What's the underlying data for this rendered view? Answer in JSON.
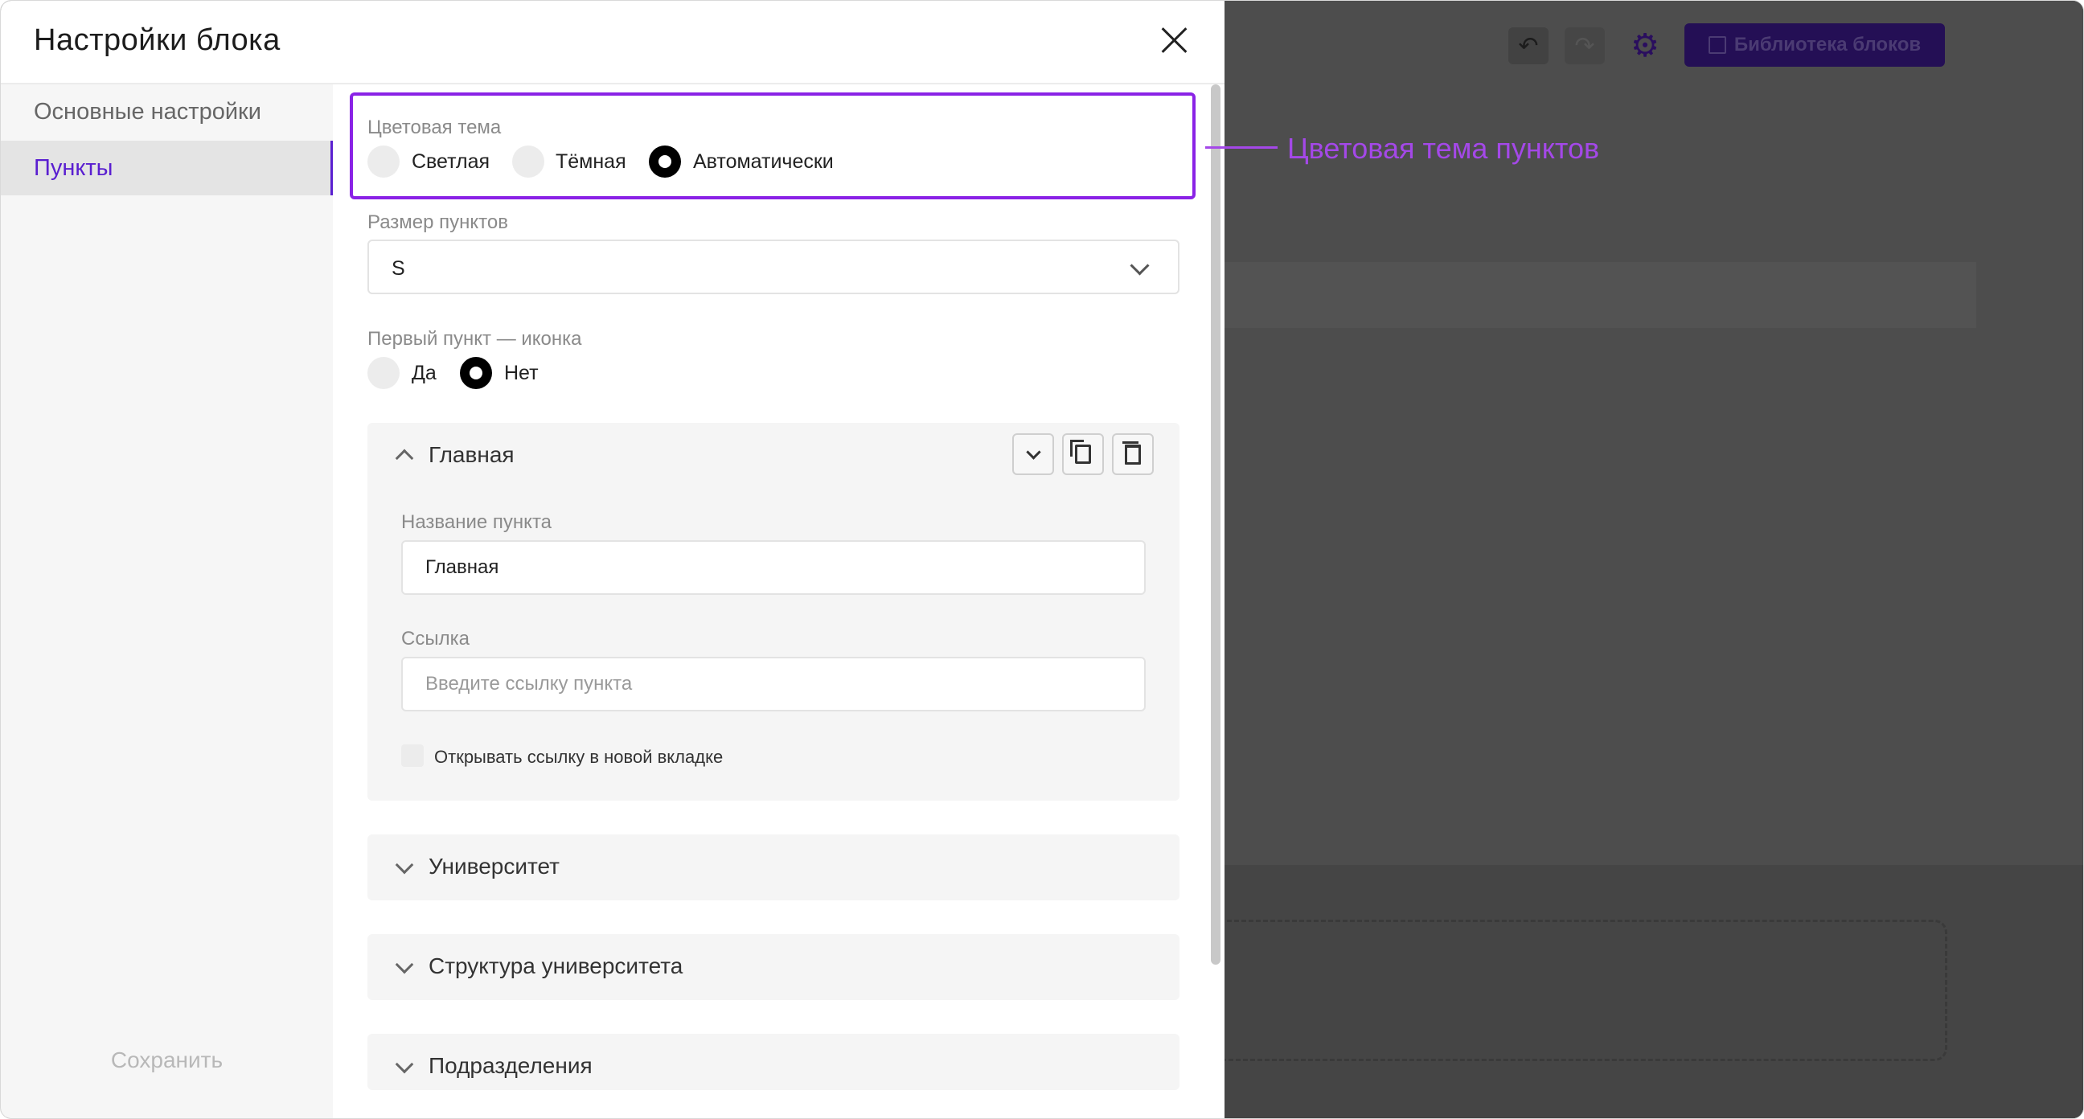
{
  "toolbar": {
    "undo_icon": "undo-icon",
    "redo_icon": "redo-icon",
    "settings_icon": "gear-icon",
    "library_label": "Библиотека блоков"
  },
  "modal": {
    "title": "Настройки блока",
    "close_icon": "close-icon"
  },
  "sidebar": {
    "items": [
      {
        "label": "Основные настройки",
        "active": false
      },
      {
        "label": "Пункты",
        "active": true
      }
    ],
    "save_label": "Сохранить"
  },
  "color_theme": {
    "label": "Цветовая тема",
    "options": [
      "Светлая",
      "Тёмная",
      "Автоматически"
    ],
    "selected": "Автоматически"
  },
  "callout": {
    "text": "Цветовая тема пунктов",
    "color": "#a448e8"
  },
  "item_size": {
    "label": "Размер пунктов",
    "value": "S"
  },
  "first_item_icon": {
    "label": "Первый пункт — иконка",
    "options": [
      "Да",
      "Нет"
    ],
    "selected": "Нет"
  },
  "items": [
    {
      "title": "Главная",
      "expanded": true,
      "name_label": "Название пункта",
      "name_value": "Главная",
      "link_label": "Ссылка",
      "link_placeholder": "Введите ссылку пункта",
      "new_tab_label": "Открывать ссылку в новой вкладке",
      "new_tab_checked": false
    },
    {
      "title": "Университет",
      "expanded": false
    },
    {
      "title": "Структура университета",
      "expanded": false
    },
    {
      "title": "Подразделения",
      "expanded": false
    }
  ],
  "colors": {
    "accent": "#5a1fd0",
    "highlight": "#8a22e6"
  }
}
